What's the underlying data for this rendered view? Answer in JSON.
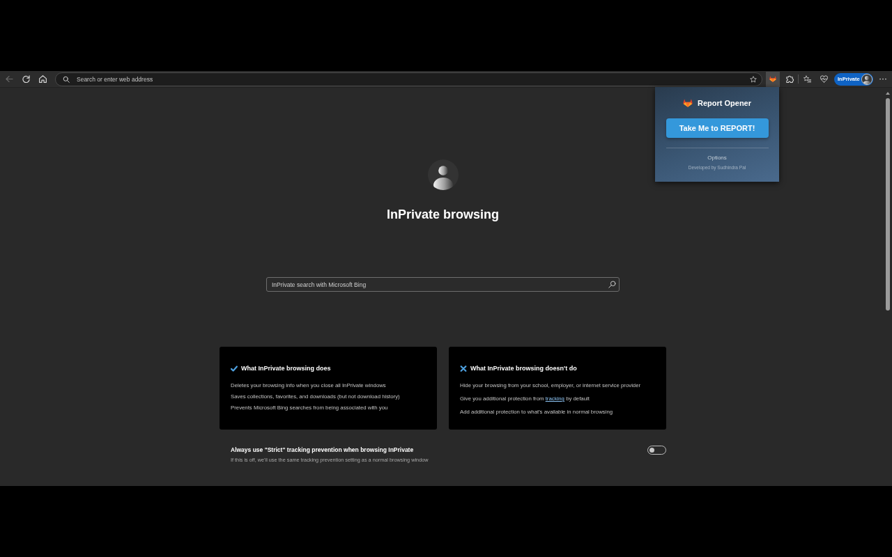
{
  "navigation": [
    {
      "kind": "back",
      "disabled": true
    },
    {
      "kind": "refresh",
      "disabled": false
    },
    {
      "kind": "home",
      "disabled": false
    }
  ],
  "address_bar": {
    "placeholder": "Search or enter web address"
  },
  "extension_button": {
    "active": true
  },
  "profile_button": {
    "label": "InPrivate"
  },
  "extension_popup": {
    "title": "Report Opener",
    "button": "Take Me to REPORT!",
    "options_link": "Options",
    "credit": "Developed by Sudhindra Pal"
  },
  "page": {
    "title": "InPrivate browsing",
    "search": {
      "placeholder": "InPrivate search with Microsoft Bing"
    },
    "cards": [
      {
        "kind": "does",
        "title": "What InPrivate browsing does",
        "items": [
          [
            {
              "kind": "text",
              "text": "Deletes your browsing info when you close all InPrivate windows"
            }
          ],
          [
            {
              "kind": "text",
              "text": "Saves collections, favorites, and downloads (but not download history)"
            }
          ],
          [
            {
              "kind": "text",
              "text": "Prevents Microsoft Bing searches from being associated with you"
            }
          ]
        ]
      },
      {
        "kind": "doesnt",
        "title": "What InPrivate browsing doesn't do",
        "items": [
          [
            {
              "kind": "text",
              "text": "Hide your browsing from your school, employer, or internet service provider"
            }
          ],
          [
            {
              "kind": "text",
              "text": "Give you additional protection from "
            },
            {
              "kind": "link",
              "text": "tracking"
            },
            {
              "kind": "text",
              "text": " by default"
            }
          ],
          [
            {
              "kind": "text",
              "text": "Add additional protection to what's available in normal browsing"
            }
          ]
        ]
      }
    ],
    "setting": {
      "label": "Always use \"Strict\" tracking prevention when browsing InPrivate",
      "description": "If this is off, we'll use the same tracking prevention setting as a normal browsing window",
      "on": false
    }
  }
}
